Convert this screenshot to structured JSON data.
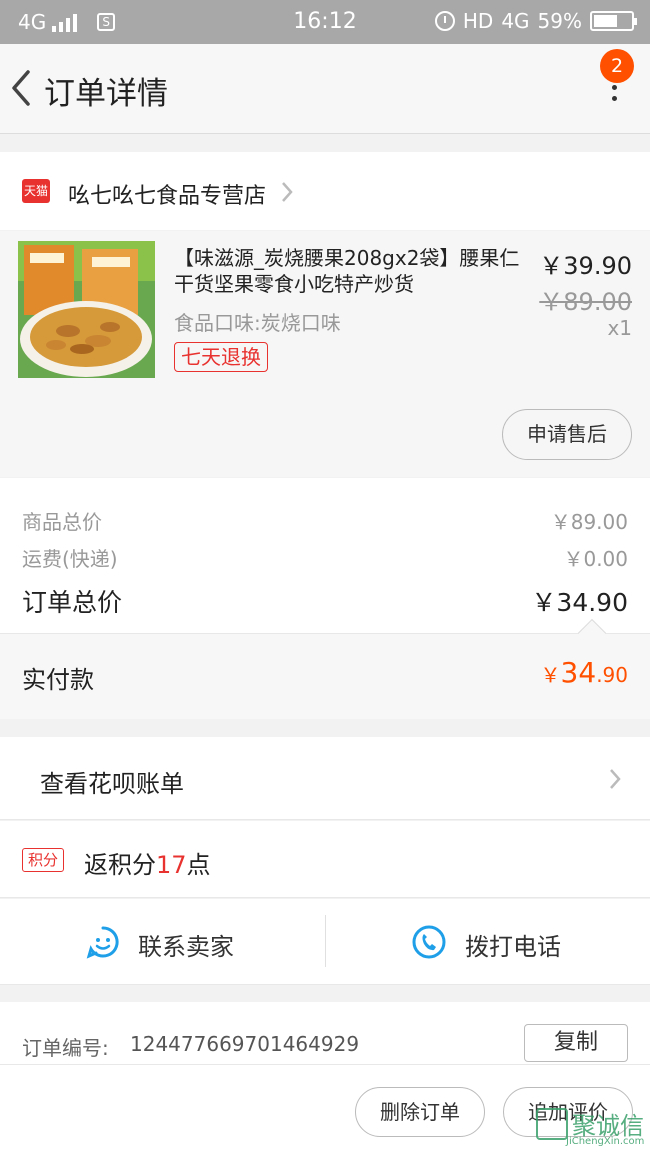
{
  "status_bar": {
    "network": "4G",
    "time": "16:12",
    "hd": "HD",
    "network_right": "4G",
    "battery": "59%",
    "battery_level": 0.59
  },
  "nav": {
    "title": "订单详情",
    "badge_count": "2"
  },
  "store": {
    "platform_tag": "天猫",
    "name": "吆七吆七食品专营店"
  },
  "product": {
    "title": "【味滋源_炭烧腰果208gx2袋】腰果仁干货坚果零食小吃特产炒货",
    "sku": "食品口味:炭烧口味",
    "service_tag": "七天退换",
    "price": "￥39.90",
    "original_price": "￥89.00",
    "quantity": "x1",
    "after_sale_button": "申请售后"
  },
  "summary": {
    "goods_total_label": "商品总价",
    "goods_total_value": "￥89.00",
    "shipping_label": "运费(快递)",
    "shipping_value": "￥0.00",
    "order_total_label": "订单总价",
    "order_total_value": "￥34.90"
  },
  "payment": {
    "label": "实付款",
    "currency": "￥",
    "amount_int": "34",
    "amount_dec": ".90"
  },
  "huabei": {
    "label": "查看花呗账单"
  },
  "points": {
    "tag": "积分",
    "prefix": "返积分",
    "number": "17",
    "suffix": "点"
  },
  "contact": {
    "seller_label": "联系卖家",
    "phone_label": "拨打电话"
  },
  "order": {
    "number_label": "订单编号:",
    "number_value": "1244776697014649​29",
    "copy_button": "复制"
  },
  "footer": {
    "delete_button": "删除订单",
    "review_button": "追加评价"
  },
  "watermark": {
    "text": "聚诚信",
    "sub": "JiChengXin.com"
  },
  "colors": {
    "accent": "#ff5000",
    "tmall_red": "#e8322f",
    "contact_blue": "#1e9fe8"
  }
}
